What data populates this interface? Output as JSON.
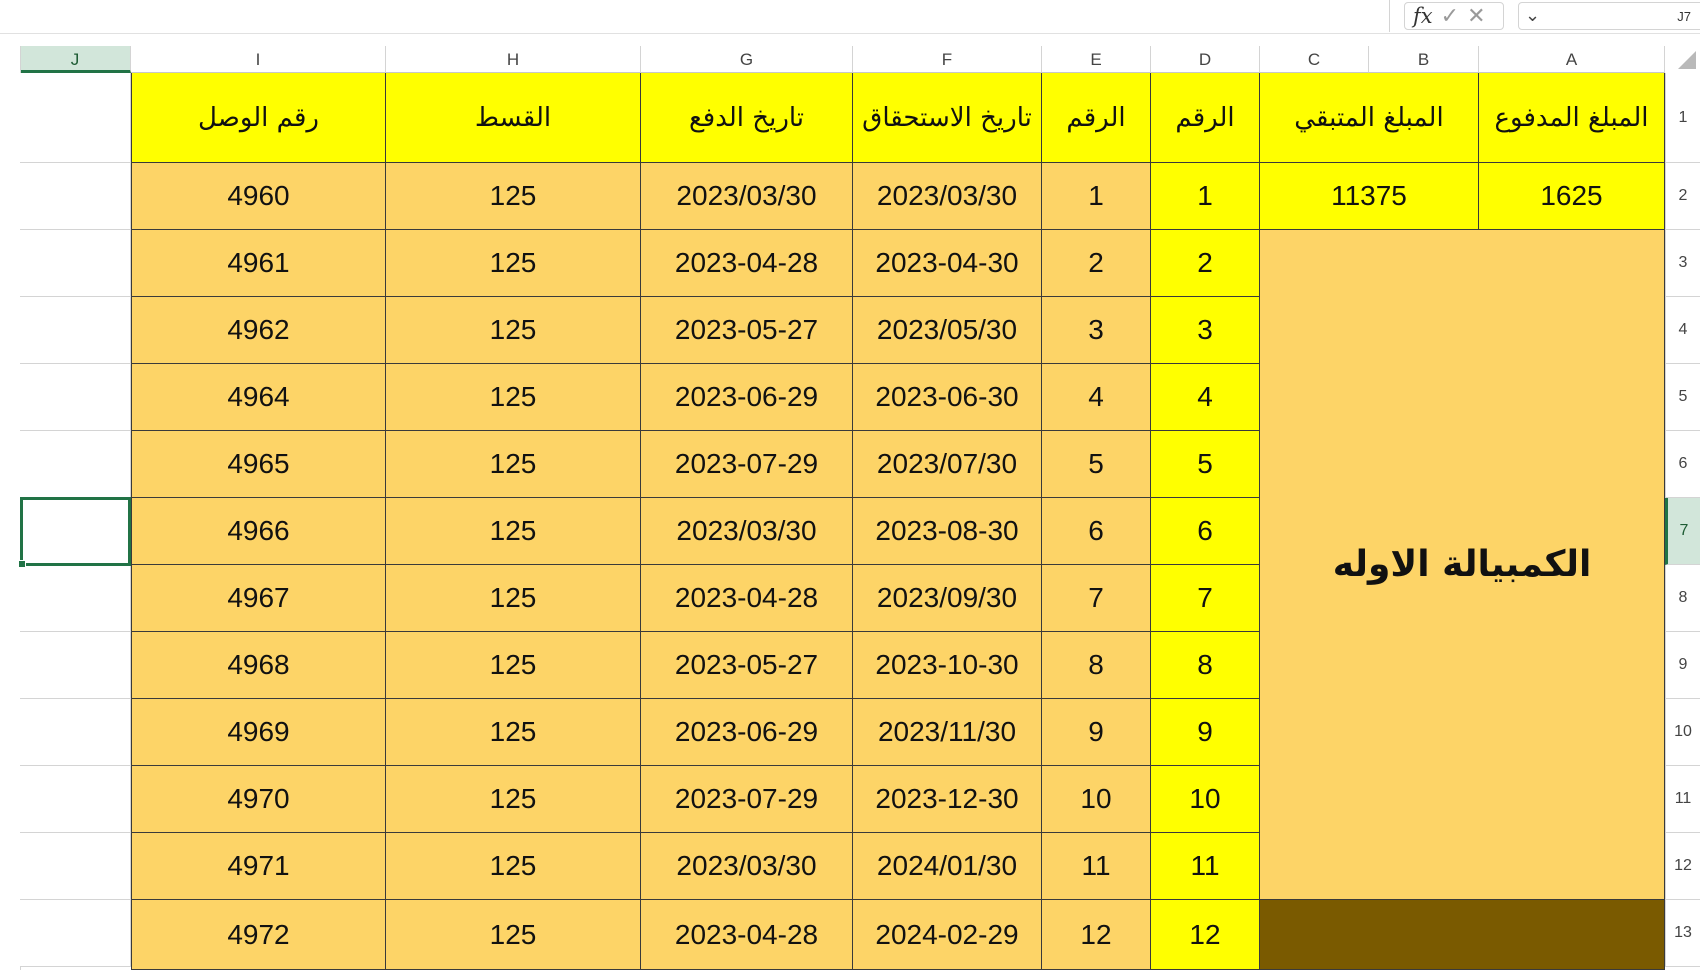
{
  "formula_bar": {
    "fx_label": "fx",
    "enter_icon": "check-icon",
    "cancel_icon": "x-icon",
    "name_box_value": "J7"
  },
  "columns": [
    "J",
    "I",
    "H",
    "G",
    "F",
    "E",
    "D",
    "C",
    "B",
    "A"
  ],
  "selected_column": "J",
  "rows": [
    "1",
    "2",
    "3",
    "4",
    "5",
    "6",
    "7",
    "8",
    "9",
    "10",
    "11",
    "12",
    "13"
  ],
  "selected_row": "7",
  "sheet": {
    "header_row": {
      "I": "رقم الوصل",
      "H": "القسط",
      "G": "تاريخ الدفع",
      "F": "تاريخ الاستحقاق",
      "E": "الرقم",
      "D": "الرقم",
      "BC": "المبلغ المتبقي",
      "A": "المبلغ المدفوع"
    },
    "summary_row": {
      "remaining": "11375",
      "paid": "1625"
    },
    "merged_label": "الكمبيالة الاوله",
    "data_rows": [
      {
        "I": "4960",
        "H": "125",
        "G": "2023/03/30",
        "F": "2023/03/30",
        "E": "1",
        "D": "1"
      },
      {
        "I": "4961",
        "H": "125",
        "G": "2023-04-28",
        "F": "2023-04-30",
        "E": "2",
        "D": "2"
      },
      {
        "I": "4962",
        "H": "125",
        "G": "2023-05-27",
        "F": "2023/05/30",
        "E": "3",
        "D": "3"
      },
      {
        "I": "4964",
        "H": "125",
        "G": "2023-06-29",
        "F": "2023-06-30",
        "E": "4",
        "D": "4"
      },
      {
        "I": "4965",
        "H": "125",
        "G": "2023-07-29",
        "F": "2023/07/30",
        "E": "5",
        "D": "5"
      },
      {
        "I": "4966",
        "H": "125",
        "G": "2023/03/30",
        "F": "2023-08-30",
        "E": "6",
        "D": "6"
      },
      {
        "I": "4967",
        "H": "125",
        "G": "2023-04-28",
        "F": "2023/09/30",
        "E": "7",
        "D": "7"
      },
      {
        "I": "4968",
        "H": "125",
        "G": "2023-05-27",
        "F": "2023-10-30",
        "E": "8",
        "D": "8"
      },
      {
        "I": "4969",
        "H": "125",
        "G": "2023-06-29",
        "F": "2023/11/30",
        "E": "9",
        "D": "9"
      },
      {
        "I": "4970",
        "H": "125",
        "G": "2023-07-29",
        "F": "2023-12-30",
        "E": "10",
        "D": "10"
      },
      {
        "I": "4971",
        "H": "125",
        "G": "2023/03/30",
        "F": "2024/01/30",
        "E": "11",
        "D": "11"
      },
      {
        "I": "4972",
        "H": "125",
        "G": "2023-04-28",
        "F": "2024-02-29",
        "E": "12",
        "D": "12"
      }
    ]
  },
  "colors": {
    "header_yellow": "#ffff00",
    "body_gold": "#fdd467",
    "dark_fill": "#7a5a00",
    "selection_green": "#217346"
  }
}
